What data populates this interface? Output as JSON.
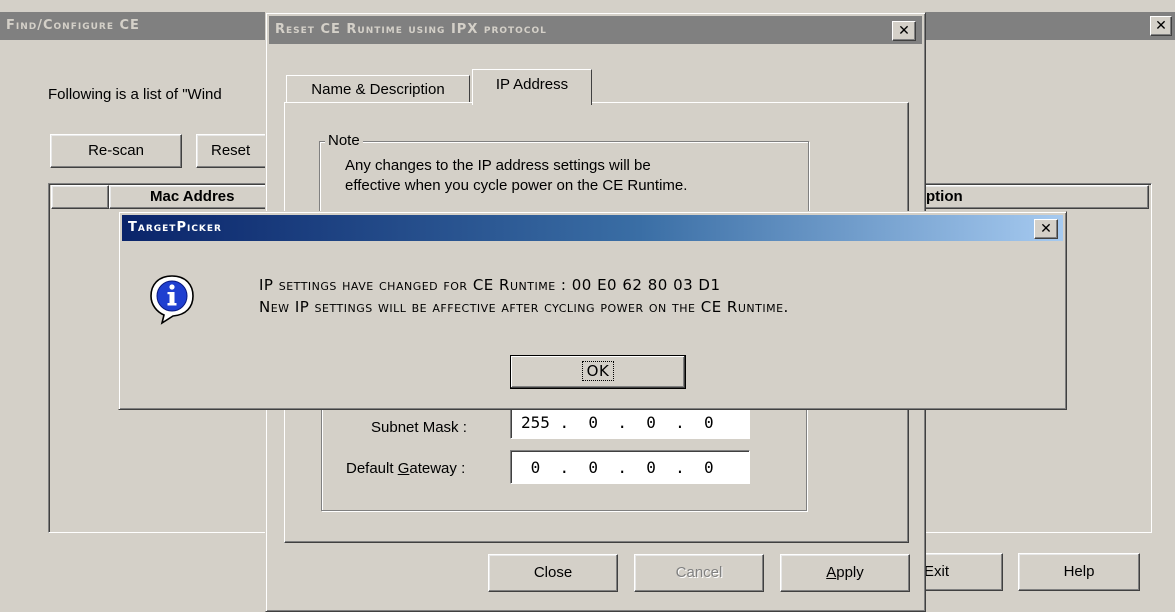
{
  "main_window": {
    "title": "Find/Configure CE",
    "description": "Following is a list of \"Wind",
    "rescan_button": "Re-scan",
    "reset_button": "Reset",
    "table_headers": [
      "",
      "Mac Addres",
      "ption"
    ],
    "exit_button": "Exit",
    "help_button": "Help",
    "close_glyph": "✕"
  },
  "reset_dialog": {
    "title": "Reset CE Runtime using IPX protocol",
    "close_glyph": "✕",
    "tabs": [
      {
        "label": "Name & Description",
        "active": false
      },
      {
        "label": "IP Address",
        "active": true
      }
    ],
    "note_label": "Note",
    "note_line1": "Any changes to the IP address settings will be",
    "note_line2": "effective when you cycle power on the CE Runtime.",
    "subnet_label": "Subnet Mask :",
    "subnet_value": "255 .  0  .  0  .  0",
    "gateway_label_pre": "Default ",
    "gateway_label_accel": "G",
    "gateway_label_post": "ateway :",
    "gateway_value": " 0  .  0  .  0  .  0",
    "close_button": "Close",
    "cancel_button": "Cancel",
    "apply_button_accel": "A",
    "apply_button_rest": "pply"
  },
  "message_box": {
    "title": "TargetPicker",
    "close_glyph": "✕",
    "icon": "information-icon",
    "line1": "IP settings have changed for CE Runtime : 00 E0 62 80 03 D1",
    "line2": "New IP settings will be affective after cycling power on the CE Runtime.",
    "ok_button": "OK"
  }
}
